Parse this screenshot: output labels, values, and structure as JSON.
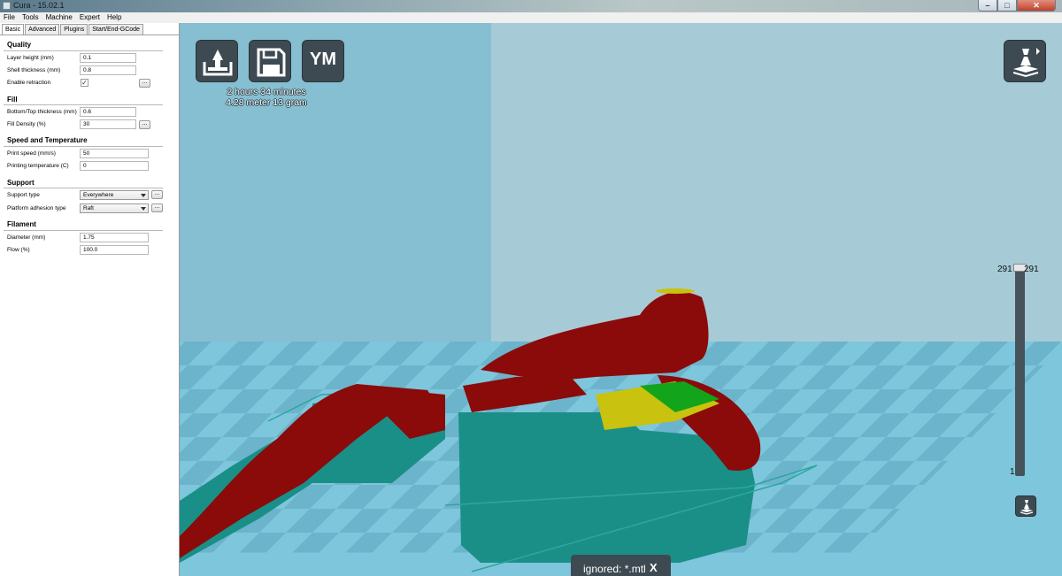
{
  "window": {
    "title": "Cura - 15.02.1",
    "controls": {
      "minimize": "–",
      "maximize": "□",
      "close": "✕"
    }
  },
  "menu": {
    "items": [
      "File",
      "Tools",
      "Machine",
      "Expert",
      "Help"
    ]
  },
  "tabs": [
    "Basic",
    "Advanced",
    "Plugins",
    "Start/End-GCode"
  ],
  "sections": {
    "quality": {
      "title": "Quality",
      "layer_height_label": "Layer height (mm)",
      "layer_height_value": "0.1",
      "shell_thickness_label": "Shell thickness (mm)",
      "shell_thickness_value": "0.8",
      "retraction_label": "Enable retraction",
      "retraction_checked": true,
      "retraction_check_glyph": "✓"
    },
    "fill": {
      "title": "Fill",
      "bottom_top_label": "Bottom/Top thickness (mm)",
      "bottom_top_value": "0.6",
      "density_label": "Fill Density (%)",
      "density_value": "30"
    },
    "speed": {
      "title": "Speed and Temperature",
      "print_speed_label": "Print speed (mm/s)",
      "print_speed_value": "50",
      "print_temp_label": "Printing temperature (C)",
      "print_temp_value": "0"
    },
    "support": {
      "title": "Support",
      "support_type_label": "Support type",
      "support_type_value": "Everywhere",
      "adhesion_label": "Platform adhesion type",
      "adhesion_value": "Raft"
    },
    "filament": {
      "title": "Filament",
      "diameter_label": "Diameter (mm)",
      "diameter_value": "1.75",
      "flow_label": "Flow (%)",
      "flow_value": "100.0"
    }
  },
  "more_button_label": "...",
  "viewport": {
    "toolbar": {
      "load_icon": "load-icon",
      "save_icon": "save-icon",
      "ym_label": "YM"
    },
    "print_info": {
      "time": "2 hours 34 minutes",
      "material": "4.28 meter 13 gram"
    },
    "layer_slider": {
      "max_left": "291",
      "max_right": "291",
      "min": "1"
    },
    "notification": {
      "message": "ignored: *.mtl",
      "close_label": "X"
    },
    "colors": {
      "background_wall": "#a6cbd7",
      "floor": "#7ec6dc",
      "model_red": "#8b0a0a",
      "model_teal": "#1a8f88",
      "model_yellow": "#c9c20e",
      "model_green": "#12a41a",
      "button_bg": "#3d4a52"
    }
  }
}
